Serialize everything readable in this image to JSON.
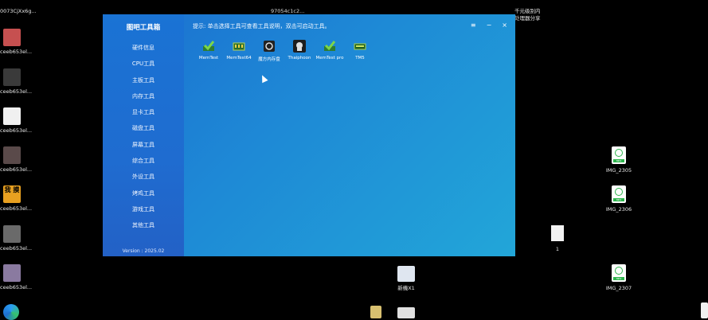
{
  "desktop": {
    "top_labels": [
      "0073CjXx6g...",
      "97054c1c2...",
      "千元级别内",
      "处理器分享"
    ],
    "left_icons": [
      {
        "label": "ceeb653el..."
      },
      {
        "label": "ceeb653el..."
      },
      {
        "label": "ceeb653el..."
      },
      {
        "label": "ceeb653el..."
      },
      {
        "label": "ceeb653el..."
      },
      {
        "label": "ceeb653el..."
      },
      {
        "label": "ceeb653el..."
      }
    ],
    "right_icons": [
      {
        "label": "IMG_2305",
        "badge": "MP4"
      },
      {
        "label": "IMG_2306",
        "badge": "MP4"
      },
      {
        "label": "1"
      },
      {
        "label": "IMG_2307",
        "badge": "MP4"
      }
    ],
    "bottom_icon_label": "新機X1",
    "left_badge_text": "我 摸"
  },
  "app": {
    "title": "图吧工具箱",
    "hint": "提示: 单击选择工具可查看工具说明，双击可启动工具。",
    "window_buttons": {
      "settings": "≡",
      "minimize": "−",
      "close": "×"
    },
    "nav": [
      "硬件信息",
      "CPU工具",
      "主板工具",
      "内存工具",
      "显卡工具",
      "磁盘工具",
      "屏幕工具",
      "综合工具",
      "外设工具",
      "烤鸡工具",
      "游戏工具",
      "其他工具"
    ],
    "version": "Version : 2025.02",
    "tools": [
      {
        "label": "MemTest",
        "icon": "check-icon"
      },
      {
        "label": "MemTest64",
        "icon": "ram-icon"
      },
      {
        "label": "魔方内存盘",
        "icon": "disk-icon"
      },
      {
        "label": "Thaiphoon",
        "icon": "thaiphoon-icon"
      },
      {
        "label": "MemTest pro",
        "icon": "check-icon"
      },
      {
        "label": "TM5",
        "icon": "ram-icon"
      }
    ]
  },
  "colors": {
    "accent": "#1e8ad6",
    "desktop": "#000000"
  }
}
